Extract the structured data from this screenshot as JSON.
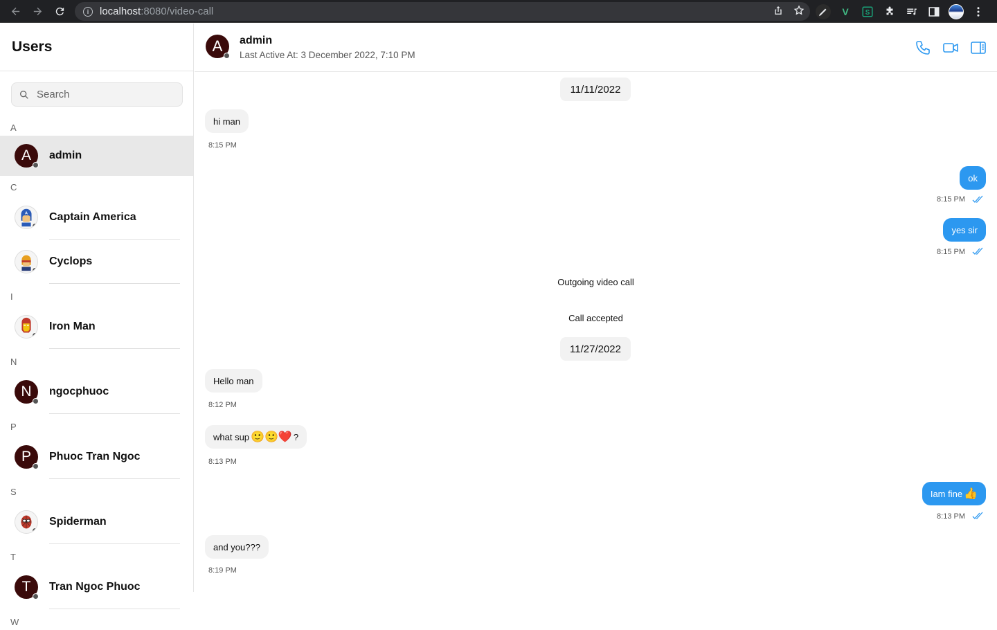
{
  "browser": {
    "url_host": "localhost",
    "url_path": ":8080/video-call"
  },
  "sidebar": {
    "title": "Users",
    "search_placeholder": "Search",
    "groups": [
      {
        "letter": "A",
        "users": [
          {
            "name": "admin",
            "initial": "A",
            "avatar": "initial",
            "active": true
          }
        ]
      },
      {
        "letter": "C",
        "users": [
          {
            "name": "Captain America",
            "avatar": "captain-america"
          },
          {
            "name": "Cyclops",
            "avatar": "cyclops"
          }
        ]
      },
      {
        "letter": "I",
        "users": [
          {
            "name": "Iron Man",
            "avatar": "iron-man"
          }
        ]
      },
      {
        "letter": "N",
        "users": [
          {
            "name": "ngocphuoc",
            "initial": "N",
            "avatar": "initial"
          }
        ]
      },
      {
        "letter": "P",
        "users": [
          {
            "name": "Phuoc Tran Ngoc",
            "initial": "P",
            "avatar": "initial"
          }
        ]
      },
      {
        "letter": "S",
        "users": [
          {
            "name": "Spiderman",
            "avatar": "spiderman"
          }
        ]
      },
      {
        "letter": "T",
        "users": [
          {
            "name": "Tran Ngoc Phuoc",
            "initial": "T",
            "avatar": "initial"
          }
        ]
      },
      {
        "letter": "W",
        "users": []
      }
    ]
  },
  "chat": {
    "name": "admin",
    "initial": "A",
    "last_active": "Last Active At: 3 December 2022, 7:10 PM",
    "actions": [
      "phone-icon",
      "video-camera-icon",
      "sidebar-toggle-icon"
    ],
    "accent_color": "#2c98f0",
    "messages": [
      {
        "type": "date",
        "text": "11/11/2022"
      },
      {
        "type": "in",
        "text": "hi man",
        "time": "8:15 PM"
      },
      {
        "type": "out",
        "text": "ok",
        "time": "8:15 PM"
      },
      {
        "type": "out",
        "text": "yes sir",
        "time": "8:15 PM"
      },
      {
        "type": "system",
        "text": "Outgoing video call"
      },
      {
        "type": "system",
        "text": "Call accepted"
      },
      {
        "type": "date",
        "text": "11/27/2022"
      },
      {
        "type": "in",
        "text": "Hello man",
        "time": "8:12 PM"
      },
      {
        "type": "in",
        "text": "what sup",
        "emojis": "🙂🙂❤️",
        "suffix": "?",
        "time": "8:13 PM"
      },
      {
        "type": "out",
        "text": "Iam fine",
        "emojis": "👍",
        "time": "8:13 PM"
      },
      {
        "type": "in",
        "text": "and you???",
        "time": "8:19 PM"
      }
    ]
  }
}
